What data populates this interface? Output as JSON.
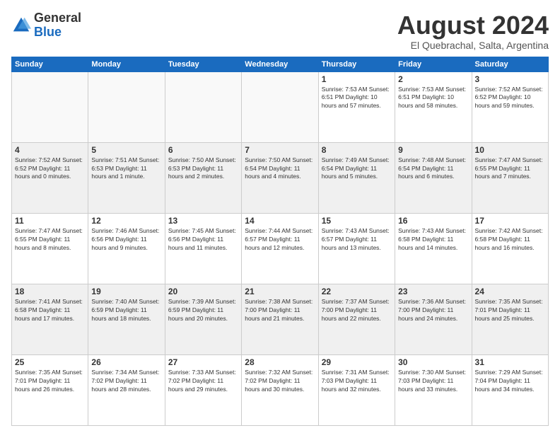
{
  "logo": {
    "general": "General",
    "blue": "Blue"
  },
  "title": "August 2024",
  "subtitle": "El Quebrachal, Salta, Argentina",
  "days_of_week": [
    "Sunday",
    "Monday",
    "Tuesday",
    "Wednesday",
    "Thursday",
    "Friday",
    "Saturday"
  ],
  "weeks": [
    [
      {
        "day": "",
        "info": ""
      },
      {
        "day": "",
        "info": ""
      },
      {
        "day": "",
        "info": ""
      },
      {
        "day": "",
        "info": ""
      },
      {
        "day": "1",
        "info": "Sunrise: 7:53 AM\nSunset: 6:51 PM\nDaylight: 10 hours\nand 57 minutes."
      },
      {
        "day": "2",
        "info": "Sunrise: 7:53 AM\nSunset: 6:51 PM\nDaylight: 10 hours\nand 58 minutes."
      },
      {
        "day": "3",
        "info": "Sunrise: 7:52 AM\nSunset: 6:52 PM\nDaylight: 10 hours\nand 59 minutes."
      }
    ],
    [
      {
        "day": "4",
        "info": "Sunrise: 7:52 AM\nSunset: 6:52 PM\nDaylight: 11 hours\nand 0 minutes."
      },
      {
        "day": "5",
        "info": "Sunrise: 7:51 AM\nSunset: 6:53 PM\nDaylight: 11 hours\nand 1 minute."
      },
      {
        "day": "6",
        "info": "Sunrise: 7:50 AM\nSunset: 6:53 PM\nDaylight: 11 hours\nand 2 minutes."
      },
      {
        "day": "7",
        "info": "Sunrise: 7:50 AM\nSunset: 6:54 PM\nDaylight: 11 hours\nand 4 minutes."
      },
      {
        "day": "8",
        "info": "Sunrise: 7:49 AM\nSunset: 6:54 PM\nDaylight: 11 hours\nand 5 minutes."
      },
      {
        "day": "9",
        "info": "Sunrise: 7:48 AM\nSunset: 6:54 PM\nDaylight: 11 hours\nand 6 minutes."
      },
      {
        "day": "10",
        "info": "Sunrise: 7:47 AM\nSunset: 6:55 PM\nDaylight: 11 hours\nand 7 minutes."
      }
    ],
    [
      {
        "day": "11",
        "info": "Sunrise: 7:47 AM\nSunset: 6:55 PM\nDaylight: 11 hours\nand 8 minutes."
      },
      {
        "day": "12",
        "info": "Sunrise: 7:46 AM\nSunset: 6:56 PM\nDaylight: 11 hours\nand 9 minutes."
      },
      {
        "day": "13",
        "info": "Sunrise: 7:45 AM\nSunset: 6:56 PM\nDaylight: 11 hours\nand 11 minutes."
      },
      {
        "day": "14",
        "info": "Sunrise: 7:44 AM\nSunset: 6:57 PM\nDaylight: 11 hours\nand 12 minutes."
      },
      {
        "day": "15",
        "info": "Sunrise: 7:43 AM\nSunset: 6:57 PM\nDaylight: 11 hours\nand 13 minutes."
      },
      {
        "day": "16",
        "info": "Sunrise: 7:43 AM\nSunset: 6:58 PM\nDaylight: 11 hours\nand 14 minutes."
      },
      {
        "day": "17",
        "info": "Sunrise: 7:42 AM\nSunset: 6:58 PM\nDaylight: 11 hours\nand 16 minutes."
      }
    ],
    [
      {
        "day": "18",
        "info": "Sunrise: 7:41 AM\nSunset: 6:58 PM\nDaylight: 11 hours\nand 17 minutes."
      },
      {
        "day": "19",
        "info": "Sunrise: 7:40 AM\nSunset: 6:59 PM\nDaylight: 11 hours\nand 18 minutes."
      },
      {
        "day": "20",
        "info": "Sunrise: 7:39 AM\nSunset: 6:59 PM\nDaylight: 11 hours\nand 20 minutes."
      },
      {
        "day": "21",
        "info": "Sunrise: 7:38 AM\nSunset: 7:00 PM\nDaylight: 11 hours\nand 21 minutes."
      },
      {
        "day": "22",
        "info": "Sunrise: 7:37 AM\nSunset: 7:00 PM\nDaylight: 11 hours\nand 22 minutes."
      },
      {
        "day": "23",
        "info": "Sunrise: 7:36 AM\nSunset: 7:00 PM\nDaylight: 11 hours\nand 24 minutes."
      },
      {
        "day": "24",
        "info": "Sunrise: 7:35 AM\nSunset: 7:01 PM\nDaylight: 11 hours\nand 25 minutes."
      }
    ],
    [
      {
        "day": "25",
        "info": "Sunrise: 7:35 AM\nSunset: 7:01 PM\nDaylight: 11 hours\nand 26 minutes."
      },
      {
        "day": "26",
        "info": "Sunrise: 7:34 AM\nSunset: 7:02 PM\nDaylight: 11 hours\nand 28 minutes."
      },
      {
        "day": "27",
        "info": "Sunrise: 7:33 AM\nSunset: 7:02 PM\nDaylight: 11 hours\nand 29 minutes."
      },
      {
        "day": "28",
        "info": "Sunrise: 7:32 AM\nSunset: 7:02 PM\nDaylight: 11 hours\nand 30 minutes."
      },
      {
        "day": "29",
        "info": "Sunrise: 7:31 AM\nSunset: 7:03 PM\nDaylight: 11 hours\nand 32 minutes."
      },
      {
        "day": "30",
        "info": "Sunrise: 7:30 AM\nSunset: 7:03 PM\nDaylight: 11 hours\nand 33 minutes."
      },
      {
        "day": "31",
        "info": "Sunrise: 7:29 AM\nSunset: 7:04 PM\nDaylight: 11 hours\nand 34 minutes."
      }
    ]
  ]
}
